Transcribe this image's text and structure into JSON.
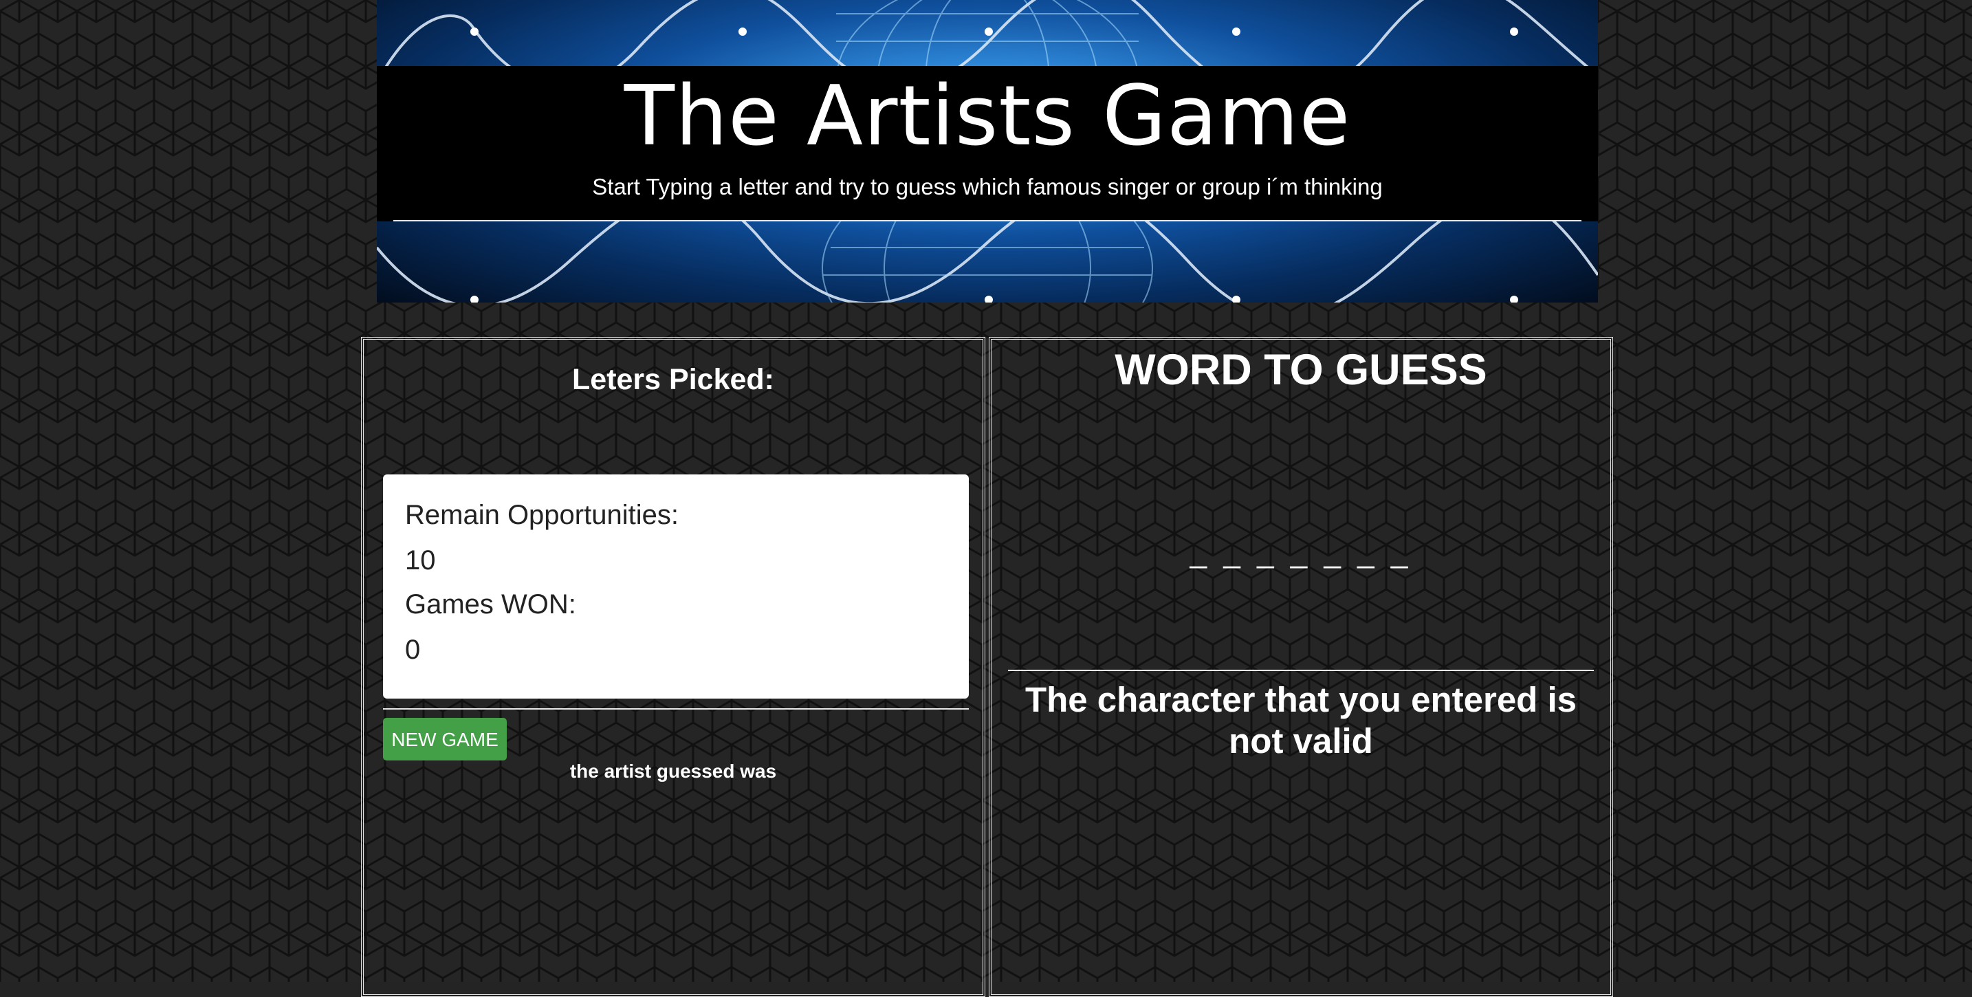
{
  "header": {
    "title": "The Artists Game",
    "subtitle": "Start Typing a letter and try to guess which famous singer or group i´m thinking"
  },
  "left_panel": {
    "letters_heading": "Leters Picked:",
    "letters_picked": "",
    "stats": {
      "remain_label": "Remain Opportunities:",
      "remain_value": "10",
      "won_label": "Games WON:",
      "won_value": "0"
    },
    "new_game_label": "NEW GAME",
    "guessed_text": "the artist guessed was"
  },
  "right_panel": {
    "heading": "WORD TO GUESS",
    "blanks": "_ _ _ _ _ _ _",
    "message": "The character that you entered is not valid"
  },
  "colors": {
    "background": "#242424",
    "button": "#43a047",
    "card": "#ffffff",
    "banner_accent": "#2d86d6"
  }
}
